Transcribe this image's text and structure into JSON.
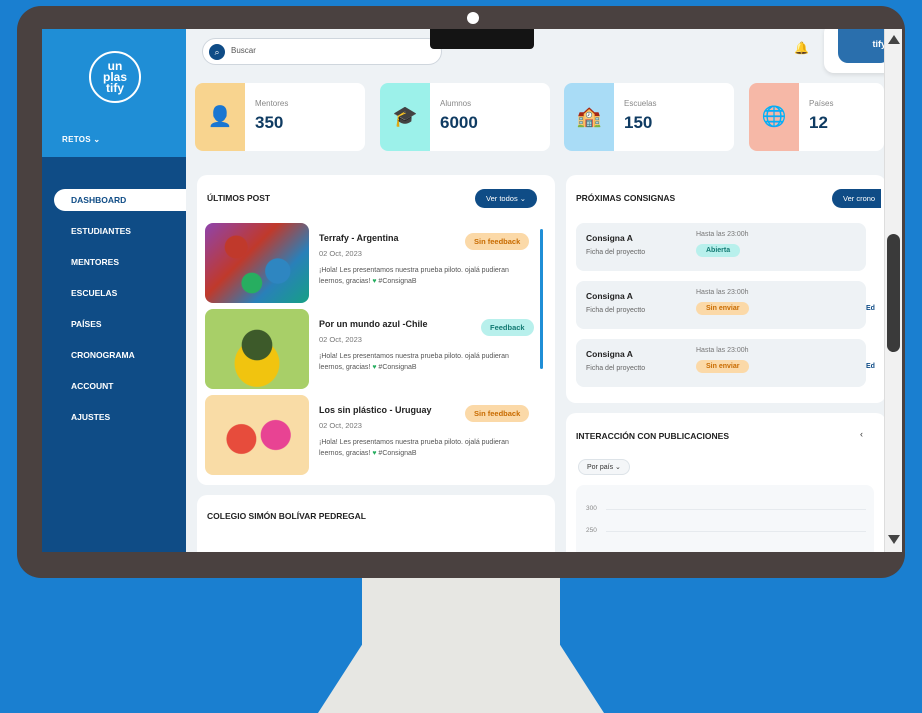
{
  "sidebar": {
    "logo_line1": "un",
    "logo_line2": "plas",
    "logo_line3": "tify",
    "retos_label": "RETOS ⌄",
    "items": [
      {
        "label": "DASHBOARD"
      },
      {
        "label": "ESTUDIANTES"
      },
      {
        "label": "MENTORES"
      },
      {
        "label": "ESCUELAS"
      },
      {
        "label": "PAÍSES"
      },
      {
        "label": "CRONOGRAMA"
      },
      {
        "label": "ACCOUNT"
      },
      {
        "label": "AJUSTES"
      }
    ]
  },
  "topbar": {
    "search_placeholder": "Buscar",
    "avatar_text": "tify"
  },
  "stats": [
    {
      "label": "Mentores",
      "value": "350",
      "icon": "mentor-icon",
      "color": "#f8d48f"
    },
    {
      "label": "Alumnos",
      "value": "6000",
      "icon": "student-icon",
      "color": "#9cf1ea"
    },
    {
      "label": "Escuelas",
      "value": "150",
      "icon": "school-icon",
      "color": "#a9dcf6"
    },
    {
      "label": "Países",
      "value": "12",
      "icon": "globe-icon",
      "color": "#f6b8a7"
    }
  ],
  "posts_card": {
    "title": "ÚLTIMOS POST",
    "button": "Ver todos ⌄",
    "posts": [
      {
        "title": "Terrafy - Argentina",
        "date": "02 Oct, 2023",
        "body": "¡Hola! Les presentamos nuestra prueba piloto. ojalá pudieran leernos, gracias!",
        "hashtag": "#ConsignaB",
        "badge": "Sin feedback"
      },
      {
        "title": "Por un mundo azul -Chile",
        "date": "02 Oct, 2023",
        "body": "¡Hola! Les presentamos nuestra prueba piloto. ojalá pudieran leernos, gracias!",
        "hashtag": "#ConsignaB",
        "badge": "Feedback"
      },
      {
        "title": "Los sin plástico - Uruguay",
        "date": "02 Oct, 2023",
        "body": "¡Hola! Les presentamos nuestra prueba piloto. ojalá pudieran leernos, gracias!",
        "hashtag": "#ConsignaB",
        "badge": "Sin feedback"
      }
    ]
  },
  "consignas_card": {
    "title": "PRÓXIMAS CONSIGNAS",
    "button": "Ver crono",
    "items": [
      {
        "name": "Consigna A",
        "sub": "Ficha del proyectto",
        "time": "Hasta las 23:00h",
        "badge": "Abierta",
        "edit": ""
      },
      {
        "name": "Consigna A",
        "sub": "Ficha del proyectto",
        "time": "Hasta las 23:00h",
        "badge": "Sin enviar",
        "edit": "Ed"
      },
      {
        "name": "Consigna A",
        "sub": "Ficha del proyectto",
        "time": "Hasta las 23:00h",
        "badge": "Sin enviar",
        "edit": "Ed"
      }
    ]
  },
  "school_card": {
    "title": "COLEGIO SIMÓN BOLÍVAR PEDREGAL"
  },
  "interaction_card": {
    "title": "INTERACCIÓN CON PUBLICACIONES",
    "nav": "‹",
    "filter": "Por país ⌄",
    "y_ticks": [
      "300",
      "250"
    ]
  }
}
